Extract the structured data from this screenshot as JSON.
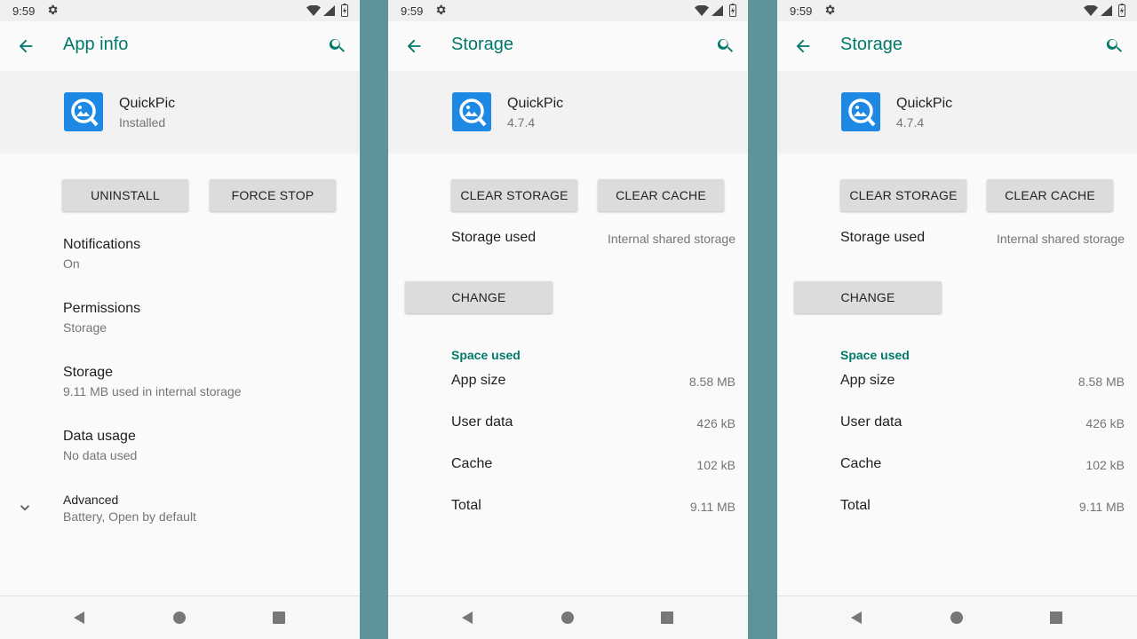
{
  "status": {
    "time": "9:59"
  },
  "app": {
    "name": "QuickPic",
    "installed_label": "Installed",
    "version": "4.7.4"
  },
  "panel1": {
    "title": "App info",
    "uninstall_label": "UNINSTALL",
    "force_stop_label": "FORCE STOP",
    "prefs": [
      {
        "title": "Notifications",
        "summary": "On"
      },
      {
        "title": "Permissions",
        "summary": "Storage"
      },
      {
        "title": "Storage",
        "summary": "9.11 MB used in internal storage"
      },
      {
        "title": "Data usage",
        "summary": "No data used"
      },
      {
        "title": "Advanced",
        "summary": "Battery, Open by default"
      }
    ]
  },
  "storage": {
    "title": "Storage",
    "clear_storage_label": "CLEAR STORAGE",
    "clear_cache_label": "CLEAR CACHE",
    "storage_used_label": "Storage used",
    "storage_used_value": "Internal shared storage",
    "change_label": "CHANGE",
    "space_used_label": "Space used",
    "rows": [
      {
        "label": "App size",
        "value": "8.58 MB"
      },
      {
        "label": "User data",
        "value": "426 kB"
      },
      {
        "label": "Cache",
        "value": "102 kB"
      },
      {
        "label": "Total",
        "value": "9.11 MB"
      }
    ]
  },
  "colors": {
    "accent": "#00796b",
    "divider": "#5f939c",
    "button": "#dcdcdc"
  },
  "icons": [
    "back-arrow-icon",
    "search-icon",
    "gear-icon",
    "wifi-icon",
    "signal-icon",
    "battery-icon",
    "quickpic-app-icon",
    "chevron-down-icon",
    "nav-back-icon",
    "nav-home-icon",
    "nav-recents-icon"
  ]
}
